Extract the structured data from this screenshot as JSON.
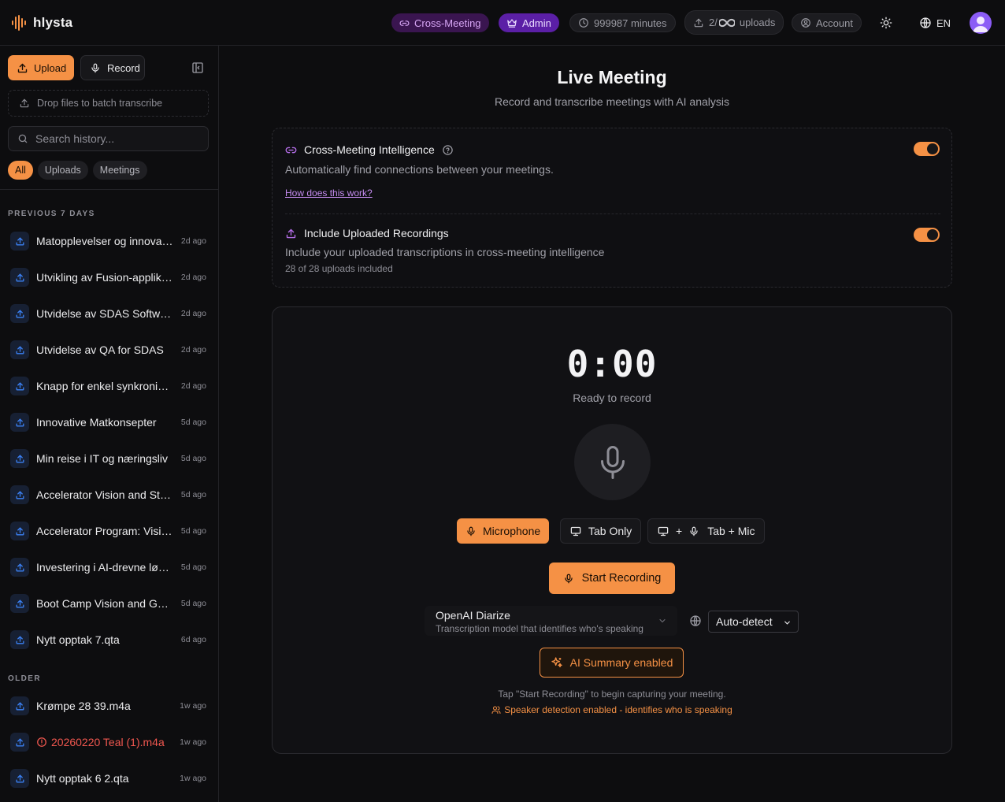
{
  "app": {
    "name": "hlysta"
  },
  "header": {
    "cross_meeting": "Cross-Meeting",
    "admin": "Admin",
    "minutes": "999987 minutes",
    "uploads_prefix": "2/",
    "uploads_suffix": "uploads",
    "account": "Account",
    "language": "EN"
  },
  "sidebar": {
    "upload_label": "Upload",
    "record_label": "Record",
    "dropzone": "Drop files to batch transcribe",
    "search_placeholder": "Search history...",
    "filters": [
      "All",
      "Uploads",
      "Meetings"
    ],
    "groups": [
      {
        "label": "PREVIOUS 7 DAYS",
        "items": [
          {
            "title": "Matopplevelser og innovasjon",
            "time": "2d ago"
          },
          {
            "title": "Utvikling av Fusion-applikasjon",
            "time": "2d ago"
          },
          {
            "title": "Utvidelse av SDAS Software",
            "time": "2d ago"
          },
          {
            "title": "Utvidelse av QA for SDAS",
            "time": "2d ago"
          },
          {
            "title": "Knapp for enkel synkronisering",
            "time": "2d ago"
          },
          {
            "title": "Innovative Matkonsepter",
            "time": "5d ago"
          },
          {
            "title": "Min reise i IT og næringsliv",
            "time": "5d ago"
          },
          {
            "title": "Accelerator Vision and Strategy",
            "time": "5d ago"
          },
          {
            "title": "Accelerator Program: Vision",
            "time": "5d ago"
          },
          {
            "title": "Investering i AI-drevne løsninger",
            "time": "5d ago"
          },
          {
            "title": "Boot Camp Vision and Goals",
            "time": "5d ago"
          },
          {
            "title": "Nytt opptak 7.qta",
            "time": "6d ago"
          }
        ]
      },
      {
        "label": "OLDER",
        "items": [
          {
            "title": "Krømpe 28 39.m4a",
            "time": "1w ago"
          },
          {
            "title": "20260220 Teal (1).m4a",
            "time": "1w ago",
            "error": true
          },
          {
            "title": "Nytt opptak 6 2.qta",
            "time": "1w ago"
          }
        ]
      }
    ]
  },
  "main": {
    "title": "Live Meeting",
    "subtitle": "Record and transcribe meetings with AI analysis",
    "cross_meeting": {
      "title": "Cross-Meeting Intelligence",
      "desc": "Automatically find connections between your meetings.",
      "link": "How does this work?",
      "enabled": true
    },
    "include_uploads": {
      "title": "Include Uploaded Recordings",
      "desc": "Include your uploaded transcriptions in cross-meeting intelligence",
      "note": "28 of 28 uploads included",
      "enabled": true
    },
    "recorder": {
      "timer": "0:00",
      "status": "Ready to record",
      "sources": {
        "microphone": "Microphone",
        "tab_only": "Tab Only",
        "plus": "+",
        "tab_mic": "Tab + Mic"
      },
      "start": "Start Recording",
      "model_name": "OpenAI Diarize",
      "model_desc": "Transcription model that identifies who's speaking",
      "language": "Auto-detect",
      "ai_summary": "AI Summary enabled",
      "hint": "Tap \"Start Recording\" to begin capturing your meeting.",
      "speaker": "Speaker detection enabled - identifies who is speaking"
    }
  },
  "colors": {
    "accent": "#f59145",
    "purple": "#8b5cf6",
    "error": "#f0574f",
    "background": "#0d0d0f"
  }
}
